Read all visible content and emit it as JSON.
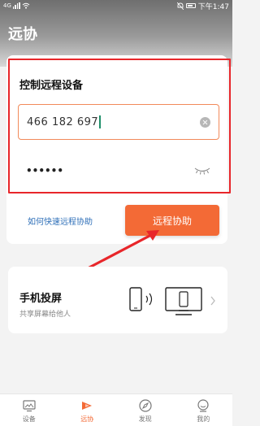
{
  "status_bar": {
    "signal": "4G",
    "time": "下午1:47"
  },
  "page_title": "远协",
  "remote_control": {
    "title": "控制远程设备",
    "device_id": "466 182 697",
    "password_mask": "••••••"
  },
  "help_link": "如何快速远程协助",
  "assist_button": "远程协助",
  "screen_share": {
    "title": "手机投屏",
    "subtitle": "共享屏幕给他人"
  },
  "bottom_nav": [
    {
      "label": "设备",
      "icon": "device-icon",
      "active": false
    },
    {
      "label": "远协",
      "icon": "remote-assist-icon",
      "active": true
    },
    {
      "label": "发现",
      "icon": "compass-icon",
      "active": false
    },
    {
      "label": "我的",
      "icon": "profile-icon",
      "active": false
    }
  ],
  "colors": {
    "accent": "#f36a36",
    "highlight_box": "#e8262a",
    "link": "#2e6fb8"
  }
}
